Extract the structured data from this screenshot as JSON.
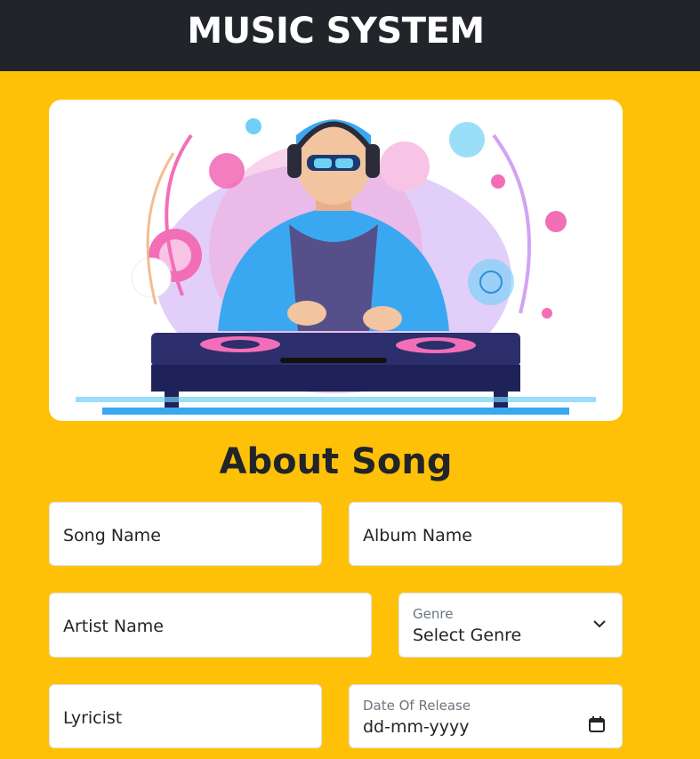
{
  "header": {
    "title": "MUSIC SYSTEM"
  },
  "hero": {
    "alt": "DJ illustration"
  },
  "section": {
    "title": "About Song"
  },
  "form": {
    "song_name": {
      "placeholder": "Song Name"
    },
    "album_name": {
      "placeholder": "Album Name"
    },
    "artist_name": {
      "placeholder": "Artist Name"
    },
    "genre": {
      "label": "Genre",
      "value": "Select Genre"
    },
    "lyricist": {
      "placeholder": "Lyricist"
    },
    "release_date": {
      "label": "Date Of Release",
      "value": "dd-mm-yyyy"
    }
  },
  "colors": {
    "page_bg": "#ffc107",
    "navbar_bg": "#212529",
    "text": "#212529"
  }
}
